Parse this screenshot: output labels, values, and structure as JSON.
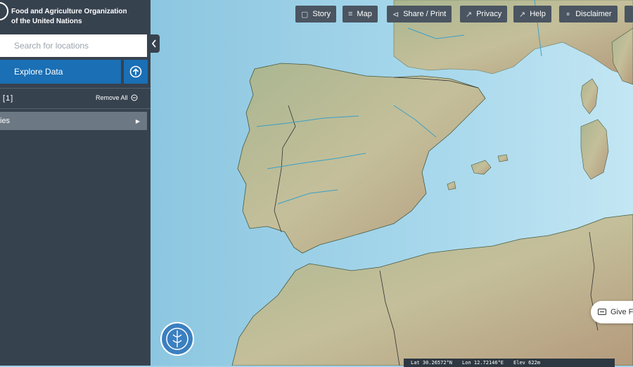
{
  "org": {
    "line1": "Food and Agriculture Organization",
    "line2": "of the United Nations"
  },
  "sidebar": {
    "search_placeholder": "Search for locations",
    "explore_label": "Explore Data",
    "selection_count": "[1]",
    "remove_all_label": "Remove All",
    "items": [
      {
        "label": "ies"
      }
    ]
  },
  "toolbar": {
    "story": "Story",
    "map": "Map",
    "share_print": "Share / Print",
    "privacy": "Privacy",
    "help": "Help",
    "disclaimer": "Disclaimer"
  },
  "feedback": {
    "label": "Give F"
  },
  "coords": {
    "lat": "Lat  30.26572°N",
    "lon": "Lon  12.72146°E",
    "elev": "Elev  622m"
  },
  "colors": {
    "sidebar_bg": "#37424f",
    "accent_blue": "#1a6fb5",
    "toolbar_bg": "#4a5561",
    "sea": "#9fd0e6",
    "land": "#b3b78f"
  }
}
